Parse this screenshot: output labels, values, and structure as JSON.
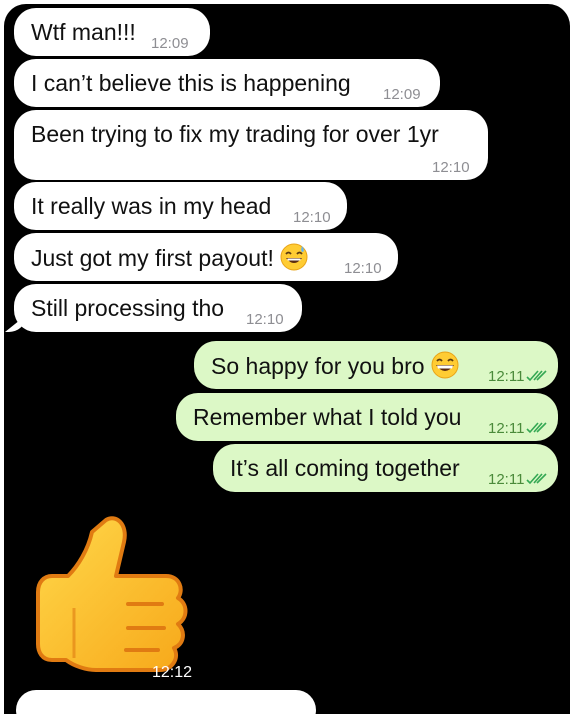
{
  "messages": [
    {
      "text": "Wtf man!!!",
      "time": "12:09",
      "dir": "in"
    },
    {
      "text": "I can’t believe this is happening",
      "time": "12:09",
      "dir": "in"
    },
    {
      "text": "Been trying to fix my trading for over 1yr",
      "time": "12:10",
      "dir": "in"
    },
    {
      "text": "It really was in my head",
      "time": "12:10",
      "dir": "in"
    },
    {
      "text": "Just got my first payout!",
      "emoji": "grinning-sweat-emoji",
      "time": "12:10",
      "dir": "in"
    },
    {
      "text": "Still processing tho",
      "time": "12:10",
      "dir": "in"
    },
    {
      "text": "So happy for you bro",
      "emoji": "beaming-grin-emoji",
      "time": "12:11",
      "dir": "out",
      "status": "read-double-check-icon"
    },
    {
      "text": "Remember what I told you",
      "time": "12:11",
      "dir": "out",
      "status": "read-double-check-icon"
    },
    {
      "text": "It’s all coming together",
      "time": "12:11",
      "dir": "out",
      "status": "read-double-check-icon"
    }
  ],
  "sticker": {
    "icon": "thumbs-up-sticker",
    "time": "12:12"
  },
  "colors": {
    "incoming": "#ffffff",
    "outgoing": "#dcf8c6",
    "background": "#000000",
    "tick": "#34a853"
  }
}
